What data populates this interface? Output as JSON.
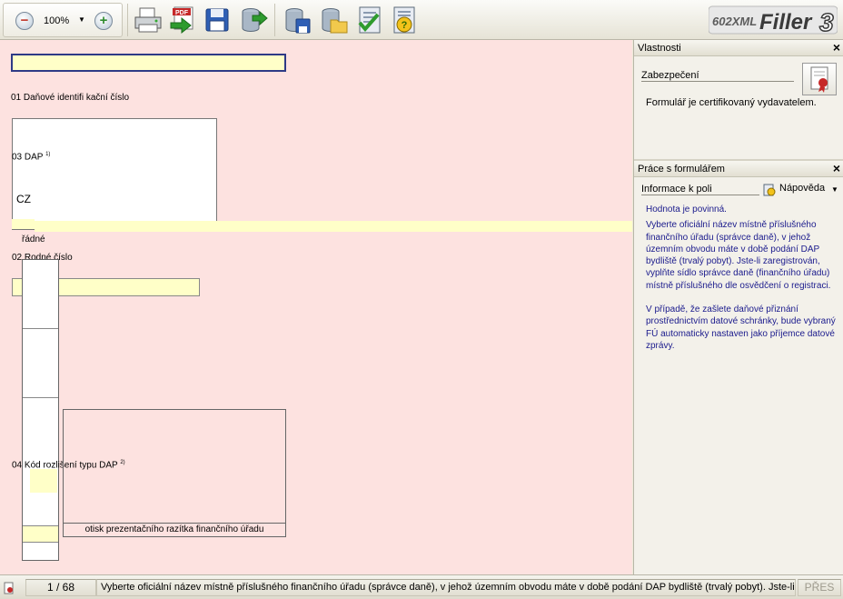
{
  "toolbar": {
    "zoom_value": "100%",
    "buttons": [
      {
        "name": "print",
        "icon": "printer-icon"
      },
      {
        "name": "export-pdf",
        "icon": "pdf-export-icon",
        "label": "PDF"
      },
      {
        "name": "save",
        "icon": "floppy-disk-icon"
      },
      {
        "name": "export-data",
        "icon": "database-export-icon"
      },
      {
        "name": "save-data",
        "icon": "database-save-icon"
      },
      {
        "name": "open-data",
        "icon": "database-open-icon"
      },
      {
        "name": "check-form",
        "icon": "checklist-icon"
      },
      {
        "name": "help",
        "icon": "help-icon"
      }
    ],
    "logo": {
      "prefix": "602XML",
      "name": "Filler",
      "version": "3"
    }
  },
  "form": {
    "label_01": "01 Daňové identifi kační číslo",
    "label_03": "03 DAP",
    "label_03_sup": "1)",
    "country_code": "CZ",
    "type_value": "řádné",
    "label_02": "02 Rodné číslo",
    "label_04": "04 Kód rozlišení typu DAP",
    "label_04_sup": "2)",
    "stamp_label": "otisk prezentačního razítka finančního úřadu"
  },
  "properties_panel": {
    "title": "Vlastnosti",
    "section": "Zabezpečení",
    "text": "Formulář je certifikovaný vydavatelem."
  },
  "work_panel": {
    "title": "Práce s formulářem",
    "section": "Informace k poli",
    "help_label": "Nápověda",
    "required": "Hodnota je povinná.",
    "paragraph1": "Vyberte oficiální název místně příslušného finančního úřadu (správce daně), v jehož územním obvodu máte v době podání DAP bydliště (trvalý pobyt). Jste-li zaregistrován, vyplňte sídlo správce daně (finančního úřadu) místně příslušného dle osvědčení o registraci.",
    "paragraph2": "V případě, že zašlete daňové přiznání prostřednictvím datové schránky, bude vybraný FÚ automaticky nastaven jako příjemce datové zprávy."
  },
  "status_bar": {
    "page": "1 / 68",
    "message": "Vyberte oficiální název místně příslušného finančního úřadu (správce daně), v jehož územním obvodu máte v době podání DAP bydliště (trvalý pobyt). Jste-li zare",
    "mode": "PŘES"
  }
}
